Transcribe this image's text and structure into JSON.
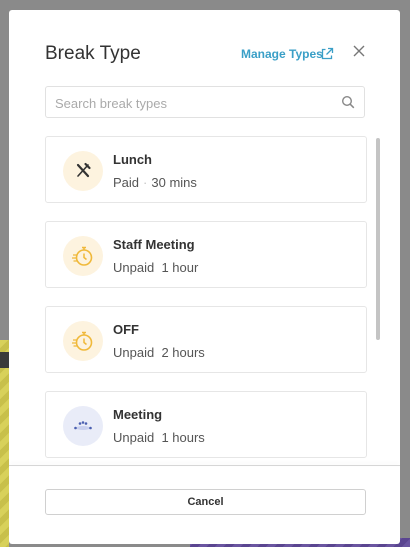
{
  "modal": {
    "title": "Break Type",
    "manage_link": "Manage Types",
    "search": {
      "placeholder": "Search break types",
      "value": ""
    },
    "cancel_label": "Cancel"
  },
  "break_types": [
    {
      "name": "Lunch",
      "pay": "Paid",
      "separator": "·",
      "duration": "30 mins",
      "icon": "fork-knife-icon"
    },
    {
      "name": "Staff Meeting",
      "pay": "Unpaid",
      "duration": "1 hour",
      "icon": "stopwatch-icon"
    },
    {
      "name": "OFF",
      "pay": "Unpaid",
      "duration": "2 hours",
      "icon": "stopwatch-icon"
    },
    {
      "name": "Meeting",
      "pay": "Unpaid",
      "duration": "1 hours",
      "icon": "meeting-icon"
    }
  ],
  "colors": {
    "accent": "#3a9fc7",
    "icon_warm": "#f0b93a",
    "badge_warm": "#fdf3df",
    "badge_cool": "#e9ecf8",
    "icon_cool": "#4a5fb0"
  }
}
